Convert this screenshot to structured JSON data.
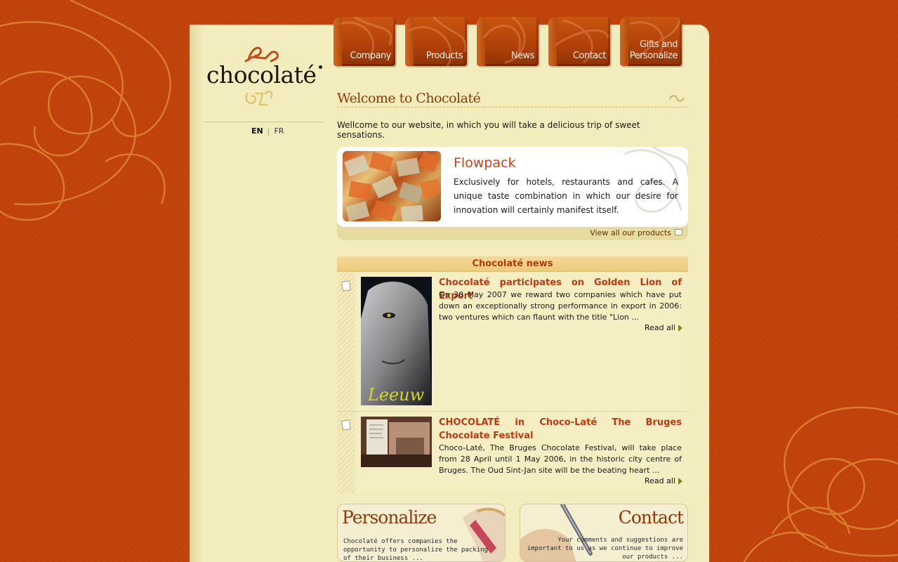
{
  "brand": {
    "logo_text": "chocolaté"
  },
  "nav": {
    "tabs": [
      {
        "label": "Company"
      },
      {
        "label": "Products"
      },
      {
        "label": "News"
      },
      {
        "label": "Contact"
      },
      {
        "label": "Gifts and Personalize"
      }
    ]
  },
  "languages": {
    "en": "EN",
    "separator": "|",
    "fr": "FR"
  },
  "welcome": {
    "title": "Welcome to Chocolaté",
    "intro": "Wellcome to our website, in which you will take a delicious trip of sweet sensations."
  },
  "flowpack": {
    "title": "Flowpack",
    "text": "Exclusively for hotels, restaurants and cafes. A unique taste combination in which our desire for innovation will certainly manifest itself.",
    "link": "View all our products"
  },
  "news": {
    "heading": "Chocolaté news",
    "items": [
      {
        "title": "Chocolaté participates on Golden Lion of Export",
        "text": "On 30 May 2007 we reward two companies which have put down an exceptionally strong performance in export in 2006: two ventures which can flaunt with the title \"Lion ...",
        "thumb_caption": "Leeuw",
        "read_all": "Read all"
      },
      {
        "title": "CHOCOLATÉ in Choco-Laté The Bruges Chocolate Festival",
        "text": "Choco-Laté, The Bruges Chocolate Festival, will take place from 28 April until 1 May 2006, in the historic city centre of Bruges. The Oud Sint-Jan site will be the beating heart ...",
        "read_all": "Read all"
      }
    ]
  },
  "promos": {
    "personalize": {
      "title": "Personalize",
      "text": "Chocolaté offers companies the opportunity to personalize the packing of their business ..."
    },
    "contact": {
      "title": "Contact",
      "text": "Your comments and suggestions are important to us as we continue to improve our products ..."
    }
  },
  "colors": {
    "background": "#c2440c",
    "page": "#f3ecbd",
    "accent": "#c03a10",
    "title_brown": "#8b3a0f"
  }
}
